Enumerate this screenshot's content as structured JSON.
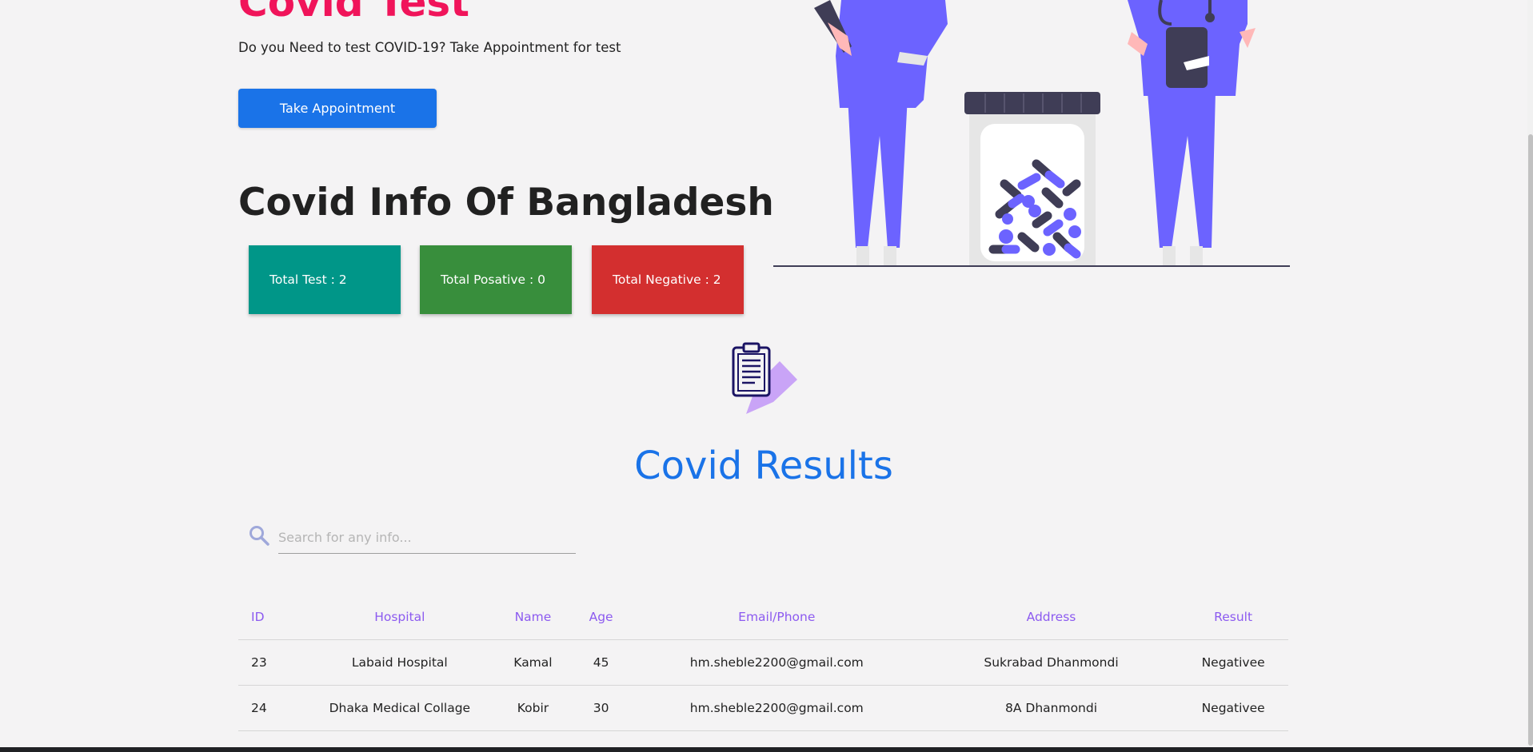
{
  "hero": {
    "title": "Covid Test",
    "subtitle": "Do you Need to test COVID-19? Take Appointment for test",
    "appointment_button": "Take Appointment"
  },
  "info": {
    "title": "Covid Info Of Bangladesh",
    "cards": [
      {
        "label": "Total Test : 2",
        "color": "#009688"
      },
      {
        "label": "Total Posative : 0",
        "color": "#388e3c"
      },
      {
        "label": "Total Negative : 2",
        "color": "#d32f2f"
      }
    ]
  },
  "results": {
    "title": "Covid Results",
    "search_placeholder": "Search for any info...",
    "columns": [
      "ID",
      "Hospital",
      "Name",
      "Age",
      "Email/Phone",
      "Address",
      "Result"
    ],
    "rows": [
      [
        "23",
        "Labaid Hospital",
        "Kamal",
        "45",
        "hm.sheble2200@gmail.com",
        "Sukrabad Dhanmondi",
        "Negativee"
      ],
      [
        "24",
        "Dhaka Medical Collage",
        "Kobir",
        "30",
        "hm.sheble2200@gmail.com",
        "8A Dhanmondi",
        "Negativee"
      ]
    ]
  },
  "icons": {
    "illustration": "doctors-with-pill-jar-illustration",
    "results_icon": "clipboard-pencil-icon",
    "search": "search-icon"
  },
  "colors": {
    "accent_pink": "#f0145a",
    "primary_blue": "#1a73e8",
    "header_purple": "#8c5af0",
    "illustration_purple": "#6c63ff"
  }
}
